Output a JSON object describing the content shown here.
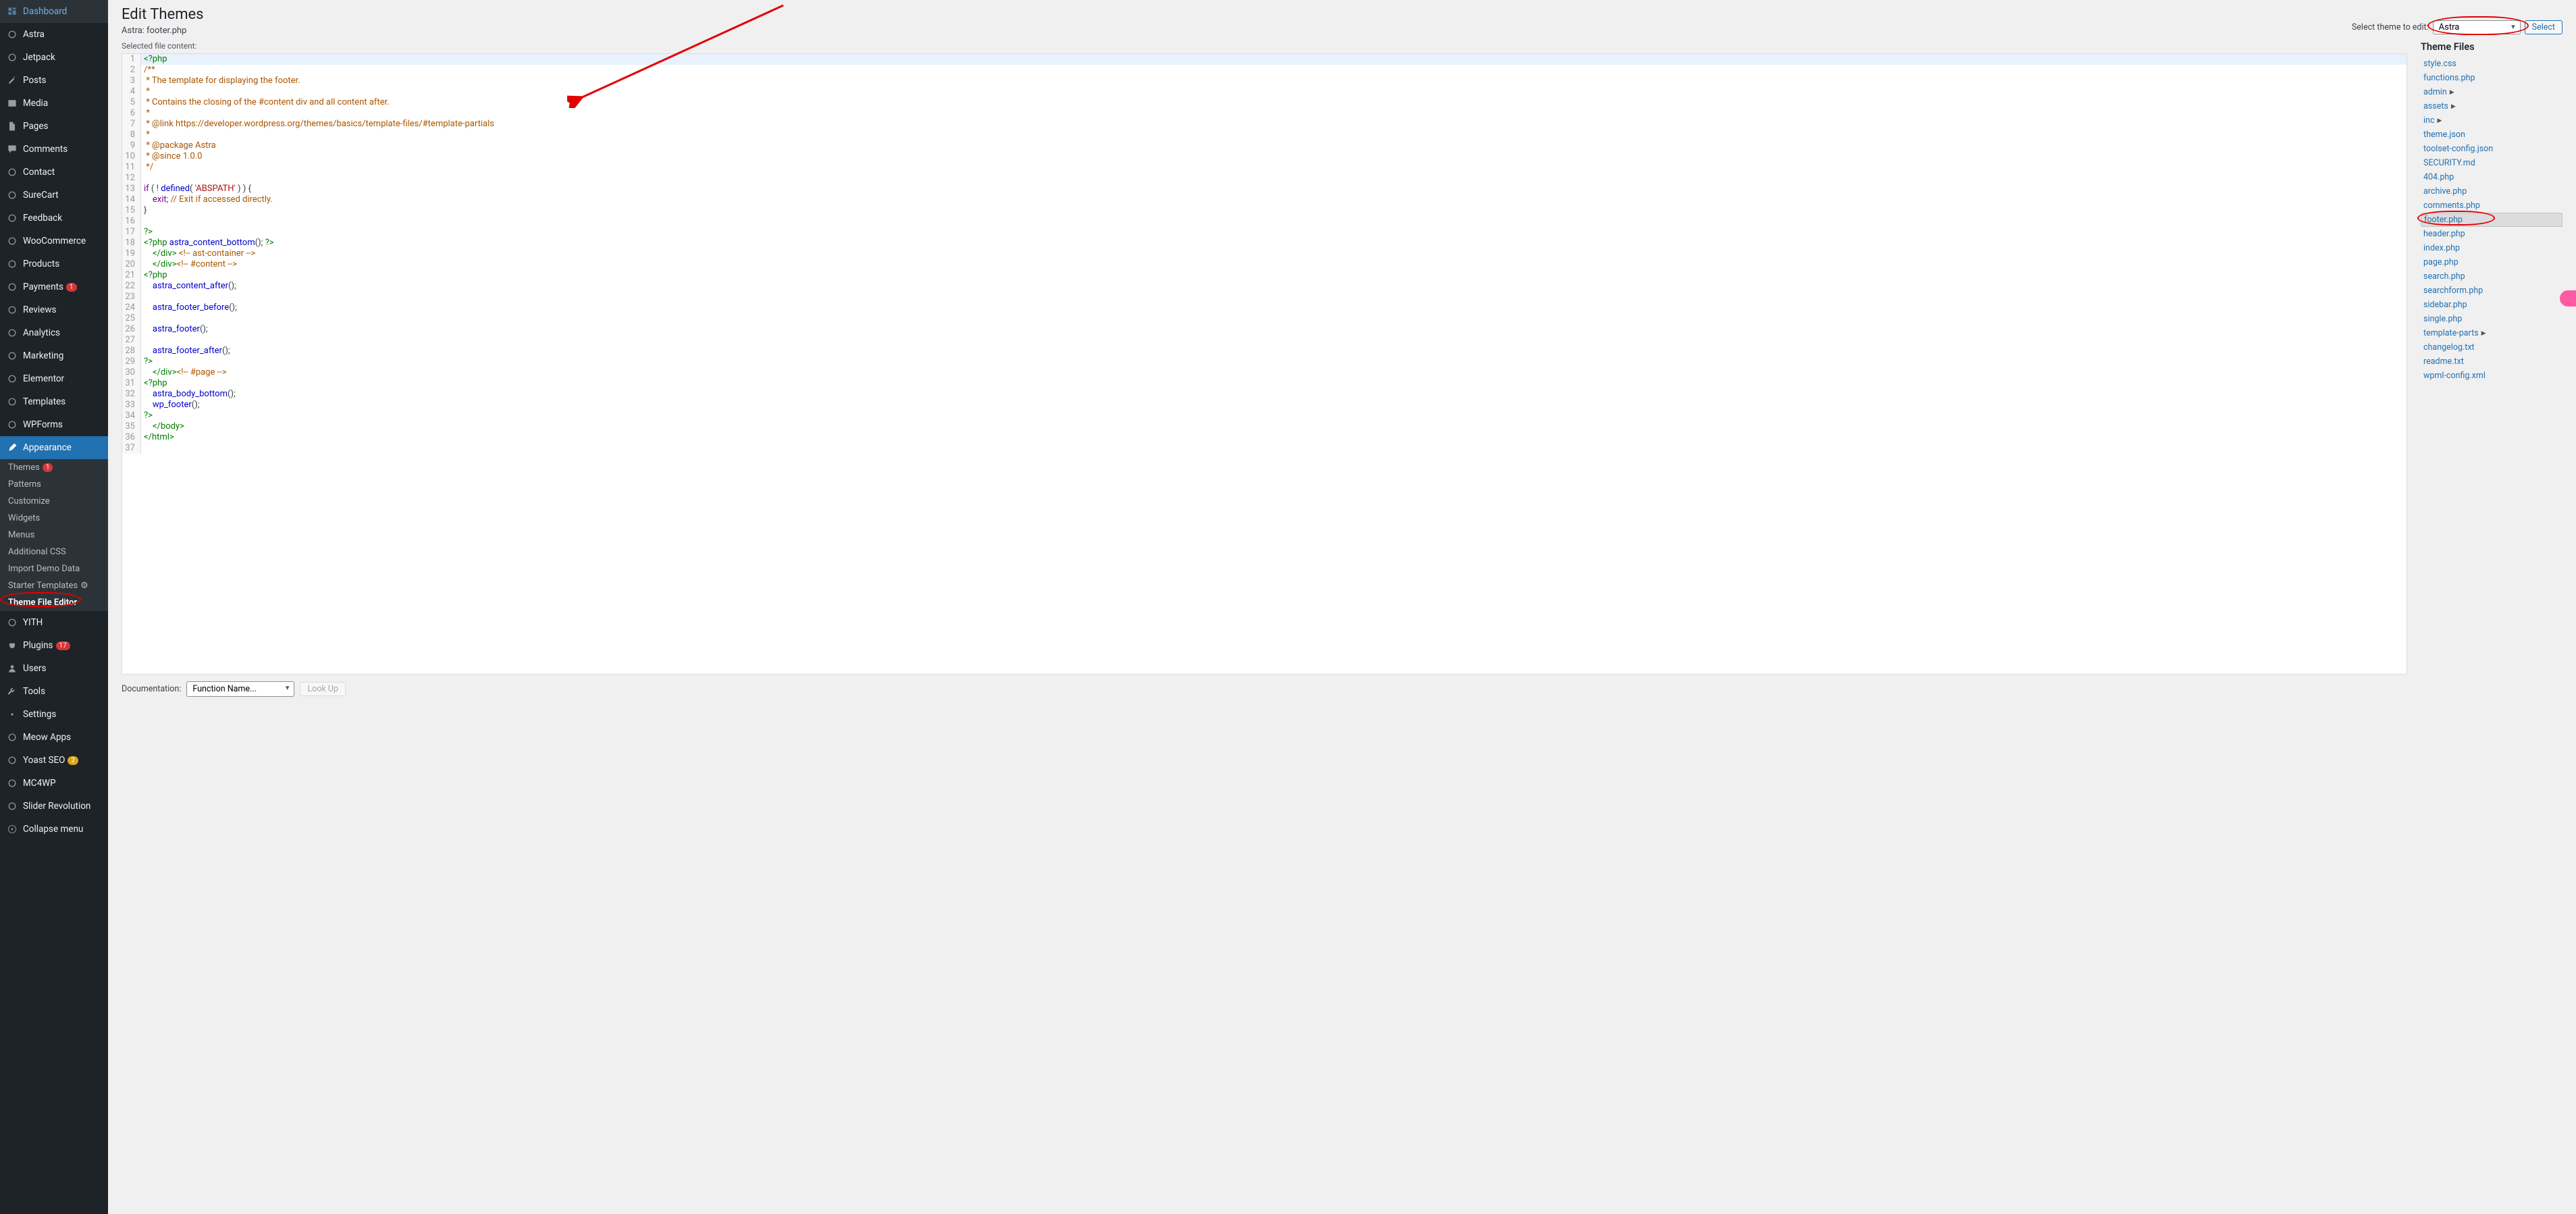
{
  "sidebar": {
    "items": [
      {
        "label": "Dashboard",
        "icon": "dashboard"
      },
      {
        "label": "Astra",
        "icon": "astra"
      },
      {
        "label": "Jetpack",
        "icon": "jetpack"
      },
      {
        "label": "Posts",
        "icon": "posts"
      },
      {
        "label": "Media",
        "icon": "media"
      },
      {
        "label": "Pages",
        "icon": "pages"
      },
      {
        "label": "Comments",
        "icon": "comments"
      },
      {
        "label": "Contact",
        "icon": "contact"
      },
      {
        "label": "SureCart",
        "icon": "surecart"
      },
      {
        "label": "Feedback",
        "icon": "feedback"
      },
      {
        "label": "WooCommerce",
        "icon": "woo"
      },
      {
        "label": "Products",
        "icon": "products"
      },
      {
        "label": "Payments",
        "icon": "payments",
        "badge": "1"
      },
      {
        "label": "Reviews",
        "icon": "reviews"
      },
      {
        "label": "Analytics",
        "icon": "analytics"
      },
      {
        "label": "Marketing",
        "icon": "marketing"
      },
      {
        "label": "Elementor",
        "icon": "elementor"
      },
      {
        "label": "Templates",
        "icon": "templates"
      },
      {
        "label": "WPForms",
        "icon": "wpforms"
      },
      {
        "label": "Appearance",
        "icon": "appearance",
        "active": true
      }
    ],
    "appearance_sub": [
      {
        "label": "Themes",
        "badge": "1"
      },
      {
        "label": "Patterns"
      },
      {
        "label": "Customize"
      },
      {
        "label": "Widgets"
      },
      {
        "label": "Menus"
      },
      {
        "label": "Additional CSS"
      },
      {
        "label": "Import Demo Data"
      },
      {
        "label": "Starter Templates",
        "gear": true
      },
      {
        "label": "Theme File Editor",
        "current": true
      }
    ],
    "items2": [
      {
        "label": "YITH",
        "icon": "yith"
      },
      {
        "label": "Plugins",
        "icon": "plugins",
        "badge": "17"
      },
      {
        "label": "Users",
        "icon": "users"
      },
      {
        "label": "Tools",
        "icon": "tools"
      },
      {
        "label": "Settings",
        "icon": "settings"
      },
      {
        "label": "Meow Apps",
        "icon": "meow"
      },
      {
        "label": "Yoast SEO",
        "icon": "yoast",
        "badge": "2",
        "badge_class": "orange"
      },
      {
        "label": "MC4WP",
        "icon": "mc4wp"
      },
      {
        "label": "Slider Revolution",
        "icon": "slider"
      },
      {
        "label": "Collapse menu",
        "icon": "collapse"
      }
    ]
  },
  "page": {
    "title": "Edit Themes",
    "subtitle": "Astra: footer.php",
    "selected_label": "Selected file content:",
    "select_theme_label": "Select theme to edit:",
    "select_theme_value": "Astra",
    "select_btn": "Select",
    "files_heading": "Theme Files",
    "doc_label": "Documentation:",
    "doc_value": "Function Name...",
    "lookup": "Look Up"
  },
  "code_lines": [
    {
      "n": 1,
      "active": true,
      "parts": [
        {
          "t": "<?php",
          "c": "c-tag"
        }
      ]
    },
    {
      "n": 2,
      "parts": [
        {
          "t": "/**",
          "c": "c-com"
        }
      ]
    },
    {
      "n": 3,
      "parts": [
        {
          "t": " * The template for displaying the footer.",
          "c": "c-com"
        }
      ]
    },
    {
      "n": 4,
      "parts": [
        {
          "t": " *",
          "c": "c-com"
        }
      ]
    },
    {
      "n": 5,
      "parts": [
        {
          "t": " * Contains the closing of the #content div and all content after.",
          "c": "c-com"
        }
      ]
    },
    {
      "n": 6,
      "parts": [
        {
          "t": " *",
          "c": "c-com"
        }
      ]
    },
    {
      "n": 7,
      "parts": [
        {
          "t": " * @link https://developer.wordpress.org/themes/basics/template-files/#template-partials",
          "c": "c-com"
        }
      ]
    },
    {
      "n": 8,
      "parts": [
        {
          "t": " *",
          "c": "c-com"
        }
      ]
    },
    {
      "n": 9,
      "parts": [
        {
          "t": " * @package Astra",
          "c": "c-com"
        }
      ]
    },
    {
      "n": 10,
      "parts": [
        {
          "t": " * @since 1.0.0",
          "c": "c-com"
        }
      ]
    },
    {
      "n": 11,
      "parts": [
        {
          "t": " */",
          "c": "c-com"
        }
      ]
    },
    {
      "n": 12,
      "parts": []
    },
    {
      "n": 13,
      "parts": [
        {
          "t": "if",
          "c": "c-key"
        },
        {
          "t": " ( "
        },
        {
          "t": "!",
          "c": "c-op"
        },
        {
          "t": " "
        },
        {
          "t": "defined",
          "c": "c-var"
        },
        {
          "t": "( "
        },
        {
          "t": "'ABSPATH'",
          "c": "c-str"
        },
        {
          "t": " ) ) {"
        }
      ]
    },
    {
      "n": 14,
      "parts": [
        {
          "t": "    "
        },
        {
          "t": "exit",
          "c": "c-key"
        },
        {
          "t": "; "
        },
        {
          "t": "// Exit if accessed directly.",
          "c": "c-com"
        }
      ]
    },
    {
      "n": 15,
      "parts": [
        {
          "t": "}"
        }
      ]
    },
    {
      "n": 16,
      "parts": []
    },
    {
      "n": 17,
      "parts": [
        {
          "t": "?>",
          "c": "c-tag"
        }
      ]
    },
    {
      "n": 18,
      "parts": [
        {
          "t": "<?php",
          "c": "c-tag"
        },
        {
          "t": " "
        },
        {
          "t": "astra_content_bottom",
          "c": "c-var"
        },
        {
          "t": "(); "
        },
        {
          "t": "?>",
          "c": "c-tag"
        }
      ]
    },
    {
      "n": 19,
      "parts": [
        {
          "t": "    "
        },
        {
          "t": "</",
          "c": "c-tag"
        },
        {
          "t": "div",
          "c": "c-tag"
        },
        {
          "t": ">",
          "c": "c-tag"
        },
        {
          "t": " "
        },
        {
          "t": "<!-- ast-container -->",
          "c": "c-com"
        }
      ]
    },
    {
      "n": 20,
      "parts": [
        {
          "t": "    "
        },
        {
          "t": "</",
          "c": "c-tag"
        },
        {
          "t": "div",
          "c": "c-tag"
        },
        {
          "t": ">",
          "c": "c-tag"
        },
        {
          "t": "<!-- #content -->",
          "c": "c-com"
        }
      ]
    },
    {
      "n": 21,
      "parts": [
        {
          "t": "<?php",
          "c": "c-tag"
        }
      ]
    },
    {
      "n": 22,
      "parts": [
        {
          "t": "    "
        },
        {
          "t": "astra_content_after",
          "c": "c-var"
        },
        {
          "t": "();"
        }
      ]
    },
    {
      "n": 23,
      "parts": []
    },
    {
      "n": 24,
      "parts": [
        {
          "t": "    "
        },
        {
          "t": "astra_footer_before",
          "c": "c-var"
        },
        {
          "t": "();"
        }
      ]
    },
    {
      "n": 25,
      "parts": []
    },
    {
      "n": 26,
      "parts": [
        {
          "t": "    "
        },
        {
          "t": "astra_footer",
          "c": "c-var"
        },
        {
          "t": "();"
        }
      ]
    },
    {
      "n": 27,
      "parts": []
    },
    {
      "n": 28,
      "parts": [
        {
          "t": "    "
        },
        {
          "t": "astra_footer_after",
          "c": "c-var"
        },
        {
          "t": "();"
        }
      ]
    },
    {
      "n": 29,
      "parts": [
        {
          "t": "?>",
          "c": "c-tag"
        }
      ]
    },
    {
      "n": 30,
      "parts": [
        {
          "t": "    "
        },
        {
          "t": "</",
          "c": "c-tag"
        },
        {
          "t": "div",
          "c": "c-tag"
        },
        {
          "t": ">",
          "c": "c-tag"
        },
        {
          "t": "<!-- #page -->",
          "c": "c-com"
        }
      ]
    },
    {
      "n": 31,
      "parts": [
        {
          "t": "<?php",
          "c": "c-tag"
        }
      ]
    },
    {
      "n": 32,
      "parts": [
        {
          "t": "    "
        },
        {
          "t": "astra_body_bottom",
          "c": "c-var"
        },
        {
          "t": "();"
        }
      ]
    },
    {
      "n": 33,
      "parts": [
        {
          "t": "    "
        },
        {
          "t": "wp_footer",
          "c": "c-var"
        },
        {
          "t": "();"
        }
      ]
    },
    {
      "n": 34,
      "parts": [
        {
          "t": "?>",
          "c": "c-tag"
        }
      ]
    },
    {
      "n": 35,
      "parts": [
        {
          "t": "    "
        },
        {
          "t": "</",
          "c": "c-tag"
        },
        {
          "t": "body",
          "c": "c-tag"
        },
        {
          "t": ">",
          "c": "c-tag"
        }
      ]
    },
    {
      "n": 36,
      "parts": [
        {
          "t": "</",
          "c": "c-tag"
        },
        {
          "t": "html",
          "c": "c-tag"
        },
        {
          "t": ">",
          "c": "c-tag"
        }
      ]
    },
    {
      "n": 37,
      "parts": []
    }
  ],
  "theme_files": [
    {
      "label": "style.css"
    },
    {
      "label": "functions.php"
    },
    {
      "label": "admin",
      "folder": true
    },
    {
      "label": "assets",
      "folder": true
    },
    {
      "label": "inc",
      "folder": true
    },
    {
      "label": "theme.json"
    },
    {
      "label": "toolset-config.json"
    },
    {
      "label": "SECURITY.md"
    },
    {
      "label": "404.php"
    },
    {
      "label": "archive.php"
    },
    {
      "label": "comments.php"
    },
    {
      "label": "footer.php",
      "current": true
    },
    {
      "label": "header.php"
    },
    {
      "label": "index.php"
    },
    {
      "label": "page.php"
    },
    {
      "label": "search.php"
    },
    {
      "label": "searchform.php"
    },
    {
      "label": "sidebar.php"
    },
    {
      "label": "single.php"
    },
    {
      "label": "template-parts",
      "folder": true
    },
    {
      "label": "changelog.txt"
    },
    {
      "label": "readme.txt"
    },
    {
      "label": "wpml-config.xml"
    }
  ]
}
